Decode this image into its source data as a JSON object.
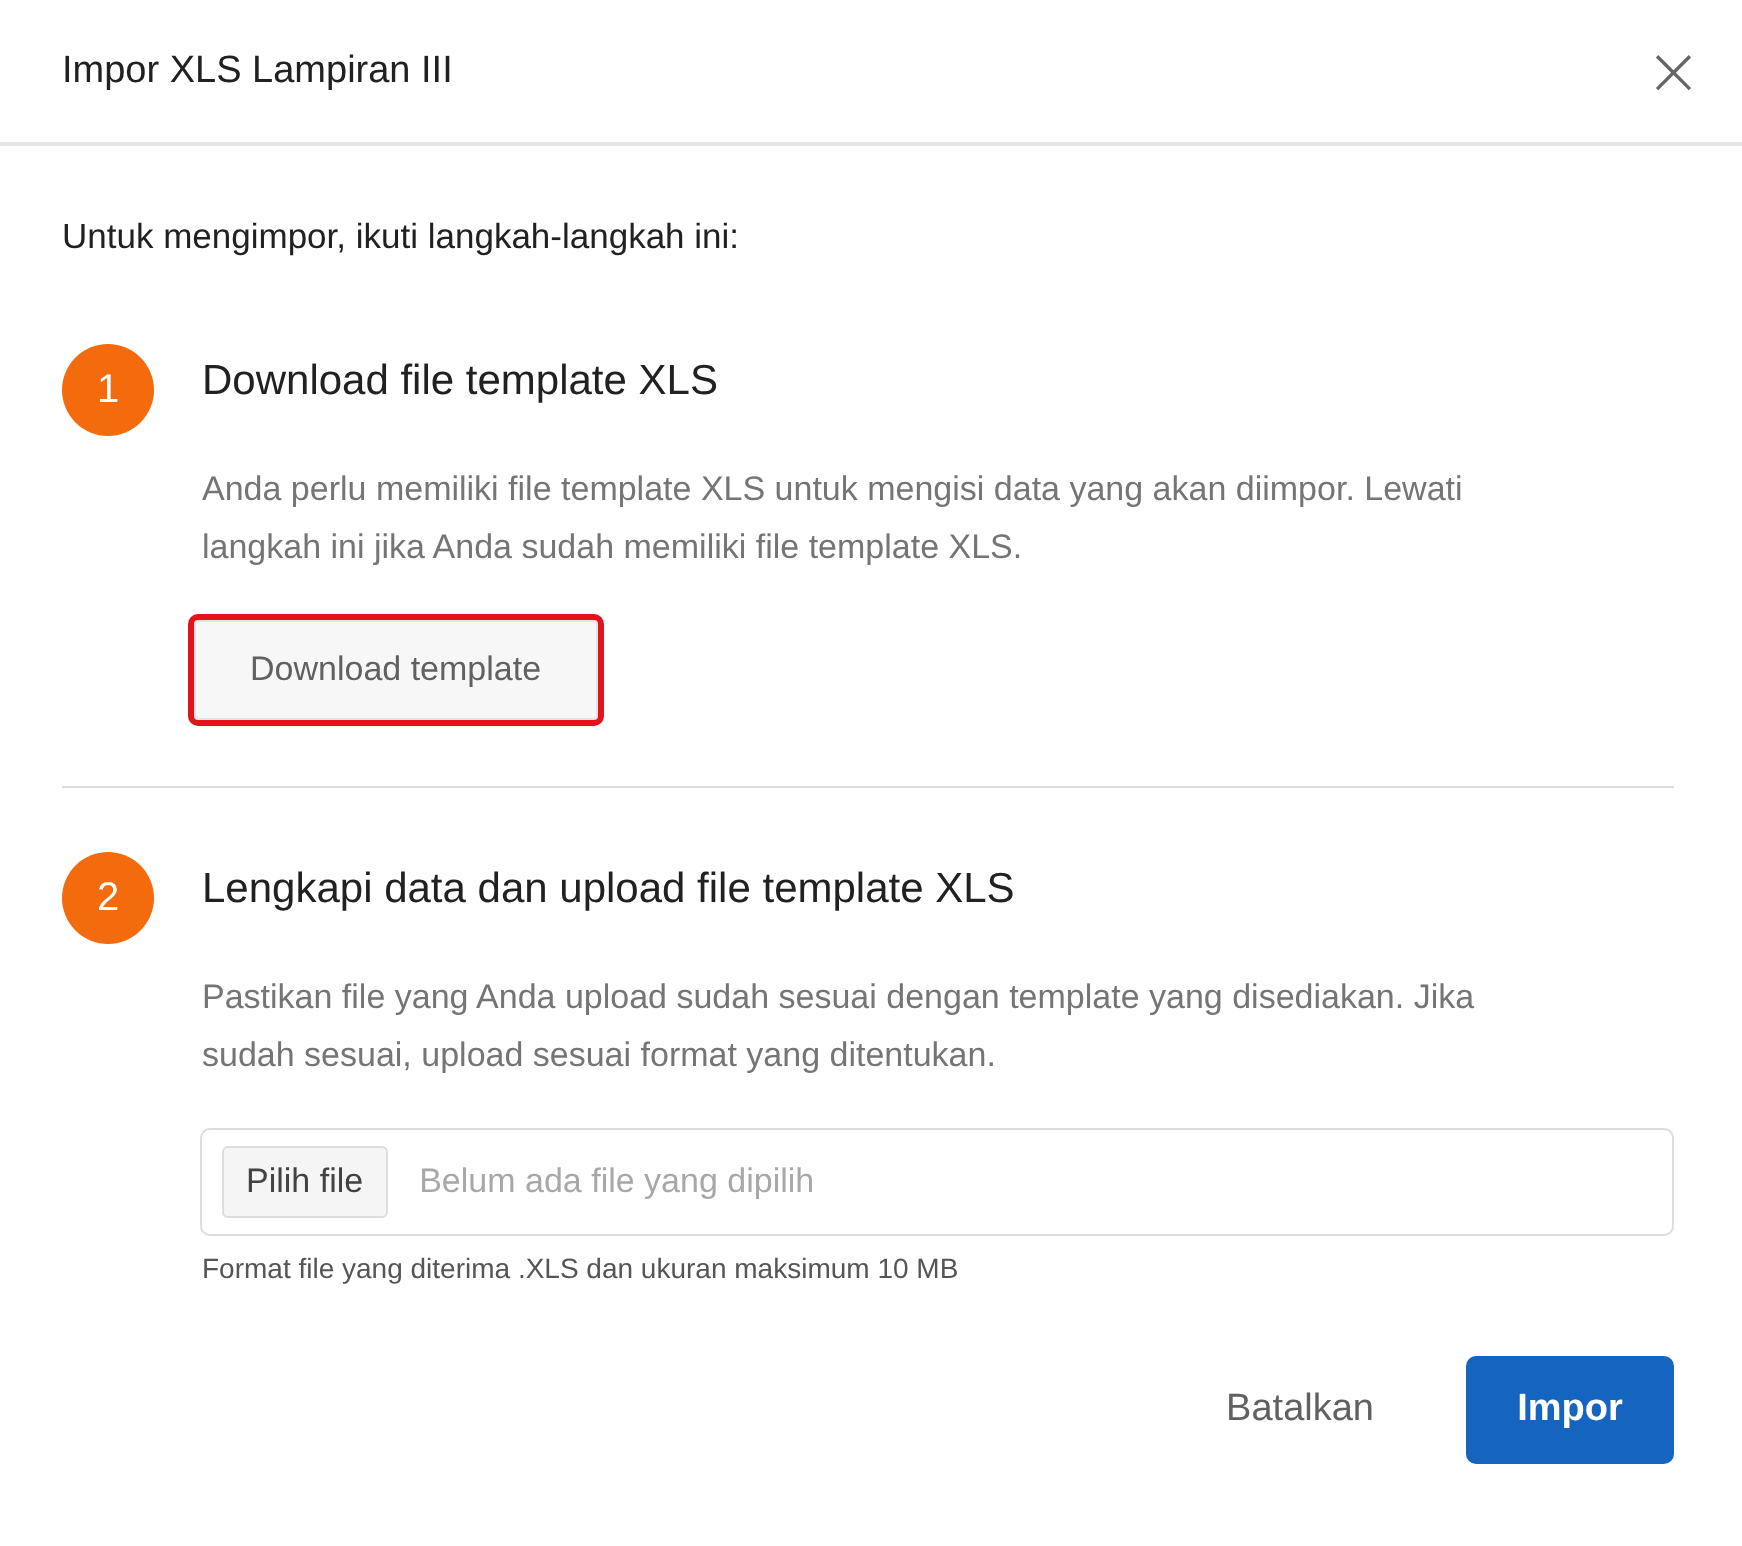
{
  "dialog": {
    "title": "Impor XLS Lampiran III",
    "close_glyph": "×"
  },
  "intro": "Untuk mengimpor, ikuti langkah-langkah ini:",
  "steps": [
    {
      "kind": "download",
      "number": "1",
      "title": "Download file template XLS",
      "description": "Anda perlu memiliki file template XLS untuk mengisi data yang akan diimpor. Lewati langkah ini jika Anda sudah memiliki file template XLS.",
      "button": {
        "label": "Download template",
        "highlighted": true
      }
    },
    {
      "kind": "upload",
      "number": "2",
      "title": "Lengkapi data dan upload file template XLS",
      "description": "Pastikan file yang Anda upload sudah sesuai dengan template yang disediakan. Jika sudah sesuai, upload sesuai format yang ditentukan.",
      "file_button": "Pilih file",
      "placeholder": "Belum ada file yang dipilih",
      "hint": "Format file yang diterima .XLS dan ukuran maksimum 10 MB"
    }
  ],
  "footer": {
    "cancel": "Batalkan",
    "submit": "Impor"
  }
}
